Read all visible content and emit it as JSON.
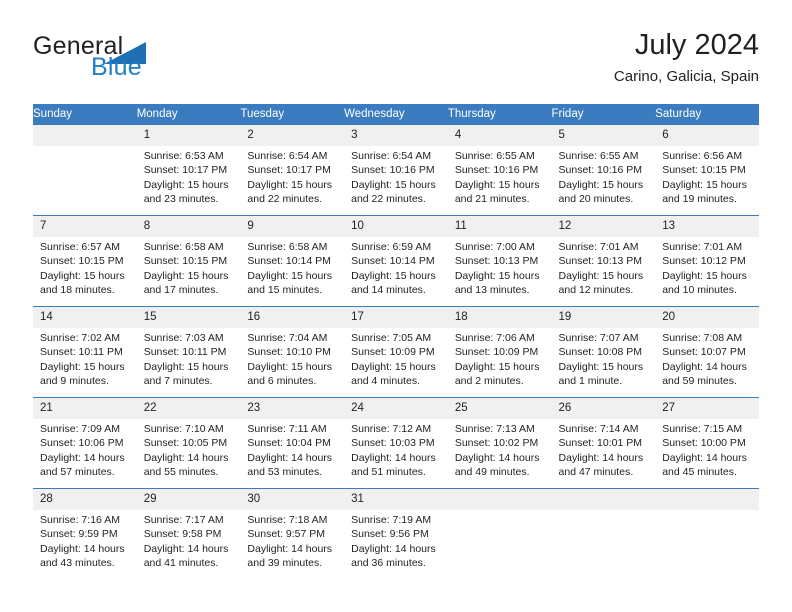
{
  "brand": {
    "name_part1": "General",
    "name_part2": "Blue",
    "triangle_icon": "blue-triangle-icon",
    "accent_color": "#1f7fc4"
  },
  "header": {
    "title": "July 2024",
    "subtitle": "Carino, Galicia, Spain"
  },
  "calendar": {
    "header_bg": "#3b7cc0",
    "daynum_bg": "#f0f0f0",
    "weekdays": [
      "Sunday",
      "Monday",
      "Tuesday",
      "Wednesday",
      "Thursday",
      "Friday",
      "Saturday"
    ],
    "weeks": [
      [
        {
          "day": "",
          "empty": true
        },
        {
          "day": "1",
          "sunrise": "Sunrise: 6:53 AM",
          "sunset": "Sunset: 10:17 PM",
          "daylight": "Daylight: 15 hours and 23 minutes."
        },
        {
          "day": "2",
          "sunrise": "Sunrise: 6:54 AM",
          "sunset": "Sunset: 10:17 PM",
          "daylight": "Daylight: 15 hours and 22 minutes."
        },
        {
          "day": "3",
          "sunrise": "Sunrise: 6:54 AM",
          "sunset": "Sunset: 10:16 PM",
          "daylight": "Daylight: 15 hours and 22 minutes."
        },
        {
          "day": "4",
          "sunrise": "Sunrise: 6:55 AM",
          "sunset": "Sunset: 10:16 PM",
          "daylight": "Daylight: 15 hours and 21 minutes."
        },
        {
          "day": "5",
          "sunrise": "Sunrise: 6:55 AM",
          "sunset": "Sunset: 10:16 PM",
          "daylight": "Daylight: 15 hours and 20 minutes."
        },
        {
          "day": "6",
          "sunrise": "Sunrise: 6:56 AM",
          "sunset": "Sunset: 10:15 PM",
          "daylight": "Daylight: 15 hours and 19 minutes."
        }
      ],
      [
        {
          "day": "7",
          "sunrise": "Sunrise: 6:57 AM",
          "sunset": "Sunset: 10:15 PM",
          "daylight": "Daylight: 15 hours and 18 minutes."
        },
        {
          "day": "8",
          "sunrise": "Sunrise: 6:58 AM",
          "sunset": "Sunset: 10:15 PM",
          "daylight": "Daylight: 15 hours and 17 minutes."
        },
        {
          "day": "9",
          "sunrise": "Sunrise: 6:58 AM",
          "sunset": "Sunset: 10:14 PM",
          "daylight": "Daylight: 15 hours and 15 minutes."
        },
        {
          "day": "10",
          "sunrise": "Sunrise: 6:59 AM",
          "sunset": "Sunset: 10:14 PM",
          "daylight": "Daylight: 15 hours and 14 minutes."
        },
        {
          "day": "11",
          "sunrise": "Sunrise: 7:00 AM",
          "sunset": "Sunset: 10:13 PM",
          "daylight": "Daylight: 15 hours and 13 minutes."
        },
        {
          "day": "12",
          "sunrise": "Sunrise: 7:01 AM",
          "sunset": "Sunset: 10:13 PM",
          "daylight": "Daylight: 15 hours and 12 minutes."
        },
        {
          "day": "13",
          "sunrise": "Sunrise: 7:01 AM",
          "sunset": "Sunset: 10:12 PM",
          "daylight": "Daylight: 15 hours and 10 minutes."
        }
      ],
      [
        {
          "day": "14",
          "sunrise": "Sunrise: 7:02 AM",
          "sunset": "Sunset: 10:11 PM",
          "daylight": "Daylight: 15 hours and 9 minutes."
        },
        {
          "day": "15",
          "sunrise": "Sunrise: 7:03 AM",
          "sunset": "Sunset: 10:11 PM",
          "daylight": "Daylight: 15 hours and 7 minutes."
        },
        {
          "day": "16",
          "sunrise": "Sunrise: 7:04 AM",
          "sunset": "Sunset: 10:10 PM",
          "daylight": "Daylight: 15 hours and 6 minutes."
        },
        {
          "day": "17",
          "sunrise": "Sunrise: 7:05 AM",
          "sunset": "Sunset: 10:09 PM",
          "daylight": "Daylight: 15 hours and 4 minutes."
        },
        {
          "day": "18",
          "sunrise": "Sunrise: 7:06 AM",
          "sunset": "Sunset: 10:09 PM",
          "daylight": "Daylight: 15 hours and 2 minutes."
        },
        {
          "day": "19",
          "sunrise": "Sunrise: 7:07 AM",
          "sunset": "Sunset: 10:08 PM",
          "daylight": "Daylight: 15 hours and 1 minute."
        },
        {
          "day": "20",
          "sunrise": "Sunrise: 7:08 AM",
          "sunset": "Sunset: 10:07 PM",
          "daylight": "Daylight: 14 hours and 59 minutes."
        }
      ],
      [
        {
          "day": "21",
          "sunrise": "Sunrise: 7:09 AM",
          "sunset": "Sunset: 10:06 PM",
          "daylight": "Daylight: 14 hours and 57 minutes."
        },
        {
          "day": "22",
          "sunrise": "Sunrise: 7:10 AM",
          "sunset": "Sunset: 10:05 PM",
          "daylight": "Daylight: 14 hours and 55 minutes."
        },
        {
          "day": "23",
          "sunrise": "Sunrise: 7:11 AM",
          "sunset": "Sunset: 10:04 PM",
          "daylight": "Daylight: 14 hours and 53 minutes."
        },
        {
          "day": "24",
          "sunrise": "Sunrise: 7:12 AM",
          "sunset": "Sunset: 10:03 PM",
          "daylight": "Daylight: 14 hours and 51 minutes."
        },
        {
          "day": "25",
          "sunrise": "Sunrise: 7:13 AM",
          "sunset": "Sunset: 10:02 PM",
          "daylight": "Daylight: 14 hours and 49 minutes."
        },
        {
          "day": "26",
          "sunrise": "Sunrise: 7:14 AM",
          "sunset": "Sunset: 10:01 PM",
          "daylight": "Daylight: 14 hours and 47 minutes."
        },
        {
          "day": "27",
          "sunrise": "Sunrise: 7:15 AM",
          "sunset": "Sunset: 10:00 PM",
          "daylight": "Daylight: 14 hours and 45 minutes."
        }
      ],
      [
        {
          "day": "28",
          "sunrise": "Sunrise: 7:16 AM",
          "sunset": "Sunset: 9:59 PM",
          "daylight": "Daylight: 14 hours and 43 minutes."
        },
        {
          "day": "29",
          "sunrise": "Sunrise: 7:17 AM",
          "sunset": "Sunset: 9:58 PM",
          "daylight": "Daylight: 14 hours and 41 minutes."
        },
        {
          "day": "30",
          "sunrise": "Sunrise: 7:18 AM",
          "sunset": "Sunset: 9:57 PM",
          "daylight": "Daylight: 14 hours and 39 minutes."
        },
        {
          "day": "31",
          "sunrise": "Sunrise: 7:19 AM",
          "sunset": "Sunset: 9:56 PM",
          "daylight": "Daylight: 14 hours and 36 minutes."
        },
        {
          "day": "",
          "empty": true
        },
        {
          "day": "",
          "empty": true
        },
        {
          "day": "",
          "empty": true
        }
      ]
    ]
  }
}
